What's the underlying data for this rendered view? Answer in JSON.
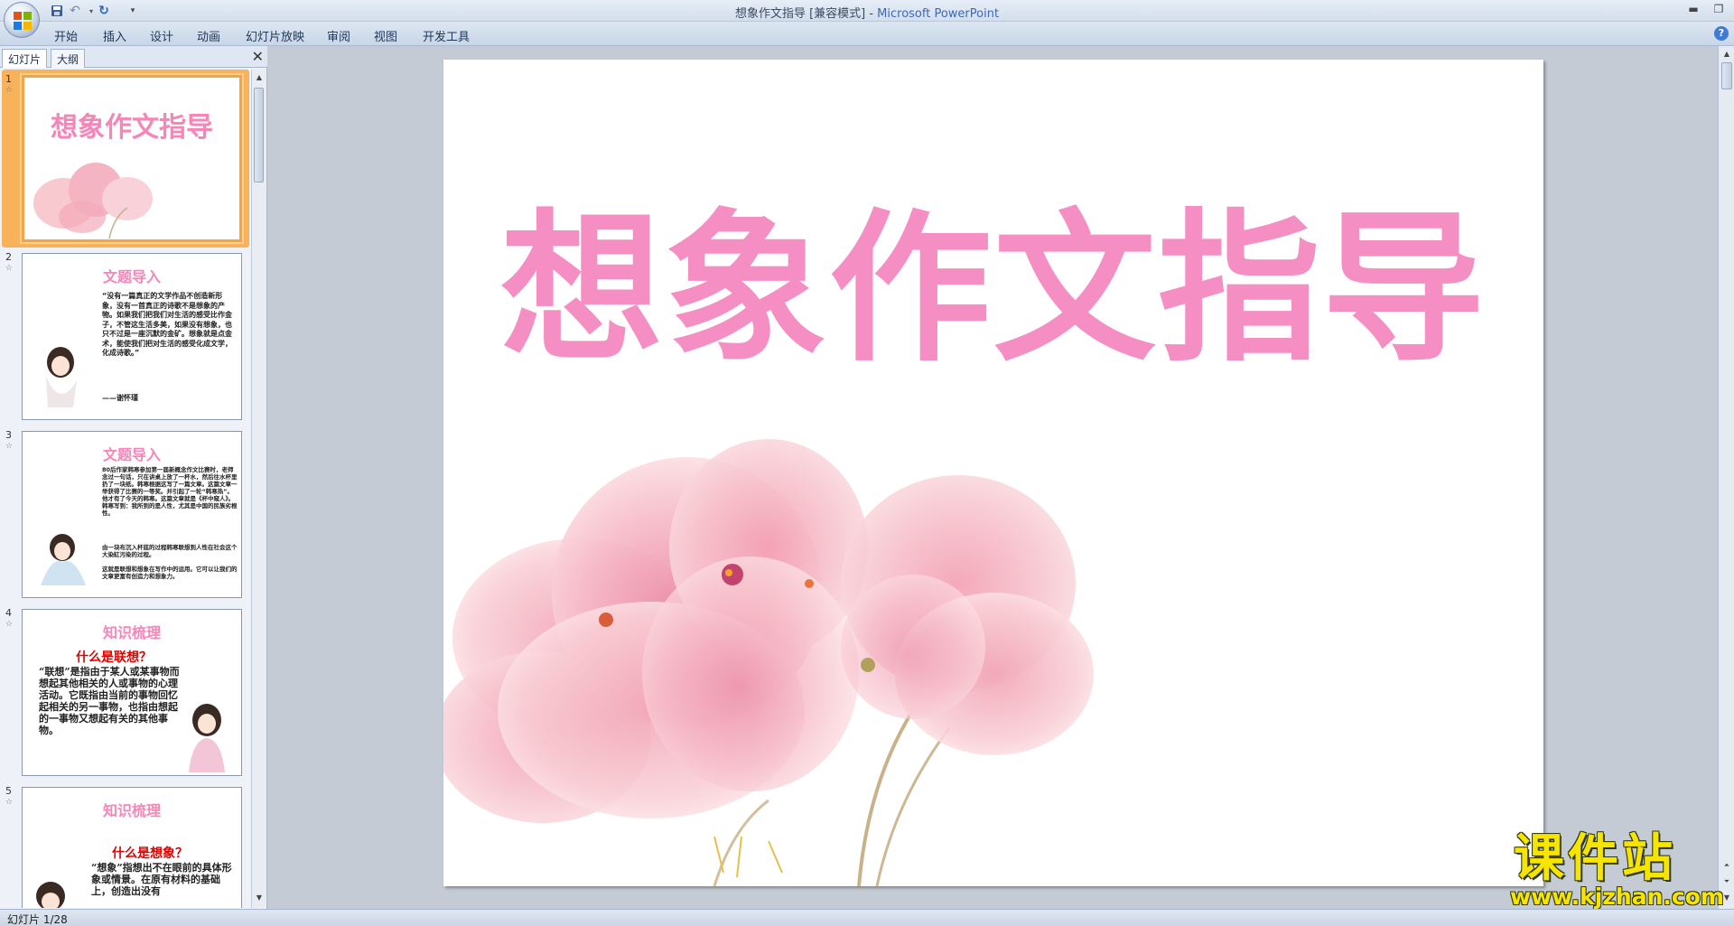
{
  "window": {
    "title": "想象作文指导 [兼容模式] - ",
    "app_name": "Microsoft PowerPoint"
  },
  "ribbon": {
    "tabs": [
      "开始",
      "插入",
      "设计",
      "动画",
      "幻灯片放映",
      "审阅",
      "视图",
      "开发工具"
    ]
  },
  "pane": {
    "tab_slides": "幻灯片",
    "tab_outline": "大纲"
  },
  "thumbnails": [
    {
      "num": "1",
      "heading": "想象作文指导"
    },
    {
      "num": "2",
      "heading": "文题导入",
      "body": "“没有一篇真正的文学作品不创造新形象，没有一首真正的诗歌不是想象的产物。如果我们把我们对生活的感受比作金子，不管这生活多美，如果没有想象，也只不过是一座沉默的金矿。想象就是点金术，能使我们把对生活的感受化成文学，化成诗歌。”",
      "author": "——谢怀瑾"
    },
    {
      "num": "3",
      "heading": "文题导入",
      "body": "80后作家韩寒参加第一届新概念作文比赛时，老师念过一句话，只在讲桌上放了一杯水，然后往水杯里扔了一块纸。韩寒根据这写了一篇文章。这篇文章一举获得了比赛的一等奖。并引起了一轮“韩寒热”。他才有了今天的韩寒。这篇文章就是《杯中窥人》。韩寒写到：我所到的是人性，尤其是中国的民族劣根性。",
      "body2": "由一块布沉入杯底的过程韩寒联想到人性在社会这个大染缸污染的过程。",
      "body3": "这就是联想和想象在写作中的运用。它可以让我们的文章更富有创造力和想象力。"
    },
    {
      "num": "4",
      "heading": "知识梳理",
      "question": "什么是联想？",
      "body": "“联想”是指由于某人或某事物而想起其他相关的人或事物的心理活动。它既指由当前的事物回忆起相关的另一事物，也指由想起的一事物又想起有关的其他事物。"
    },
    {
      "num": "5",
      "heading": "知识梳理",
      "question": "什么是想象？",
      "body": "“想象”指想出不在眼前的具体形象或情景。在原有材料的基础上，创造出没有"
    }
  ],
  "slide": {
    "title": "想象作文指导"
  },
  "status": {
    "text": "幻灯片 1/28"
  },
  "watermark": {
    "big": "课件站",
    "url": "www.kjzhan.com"
  }
}
